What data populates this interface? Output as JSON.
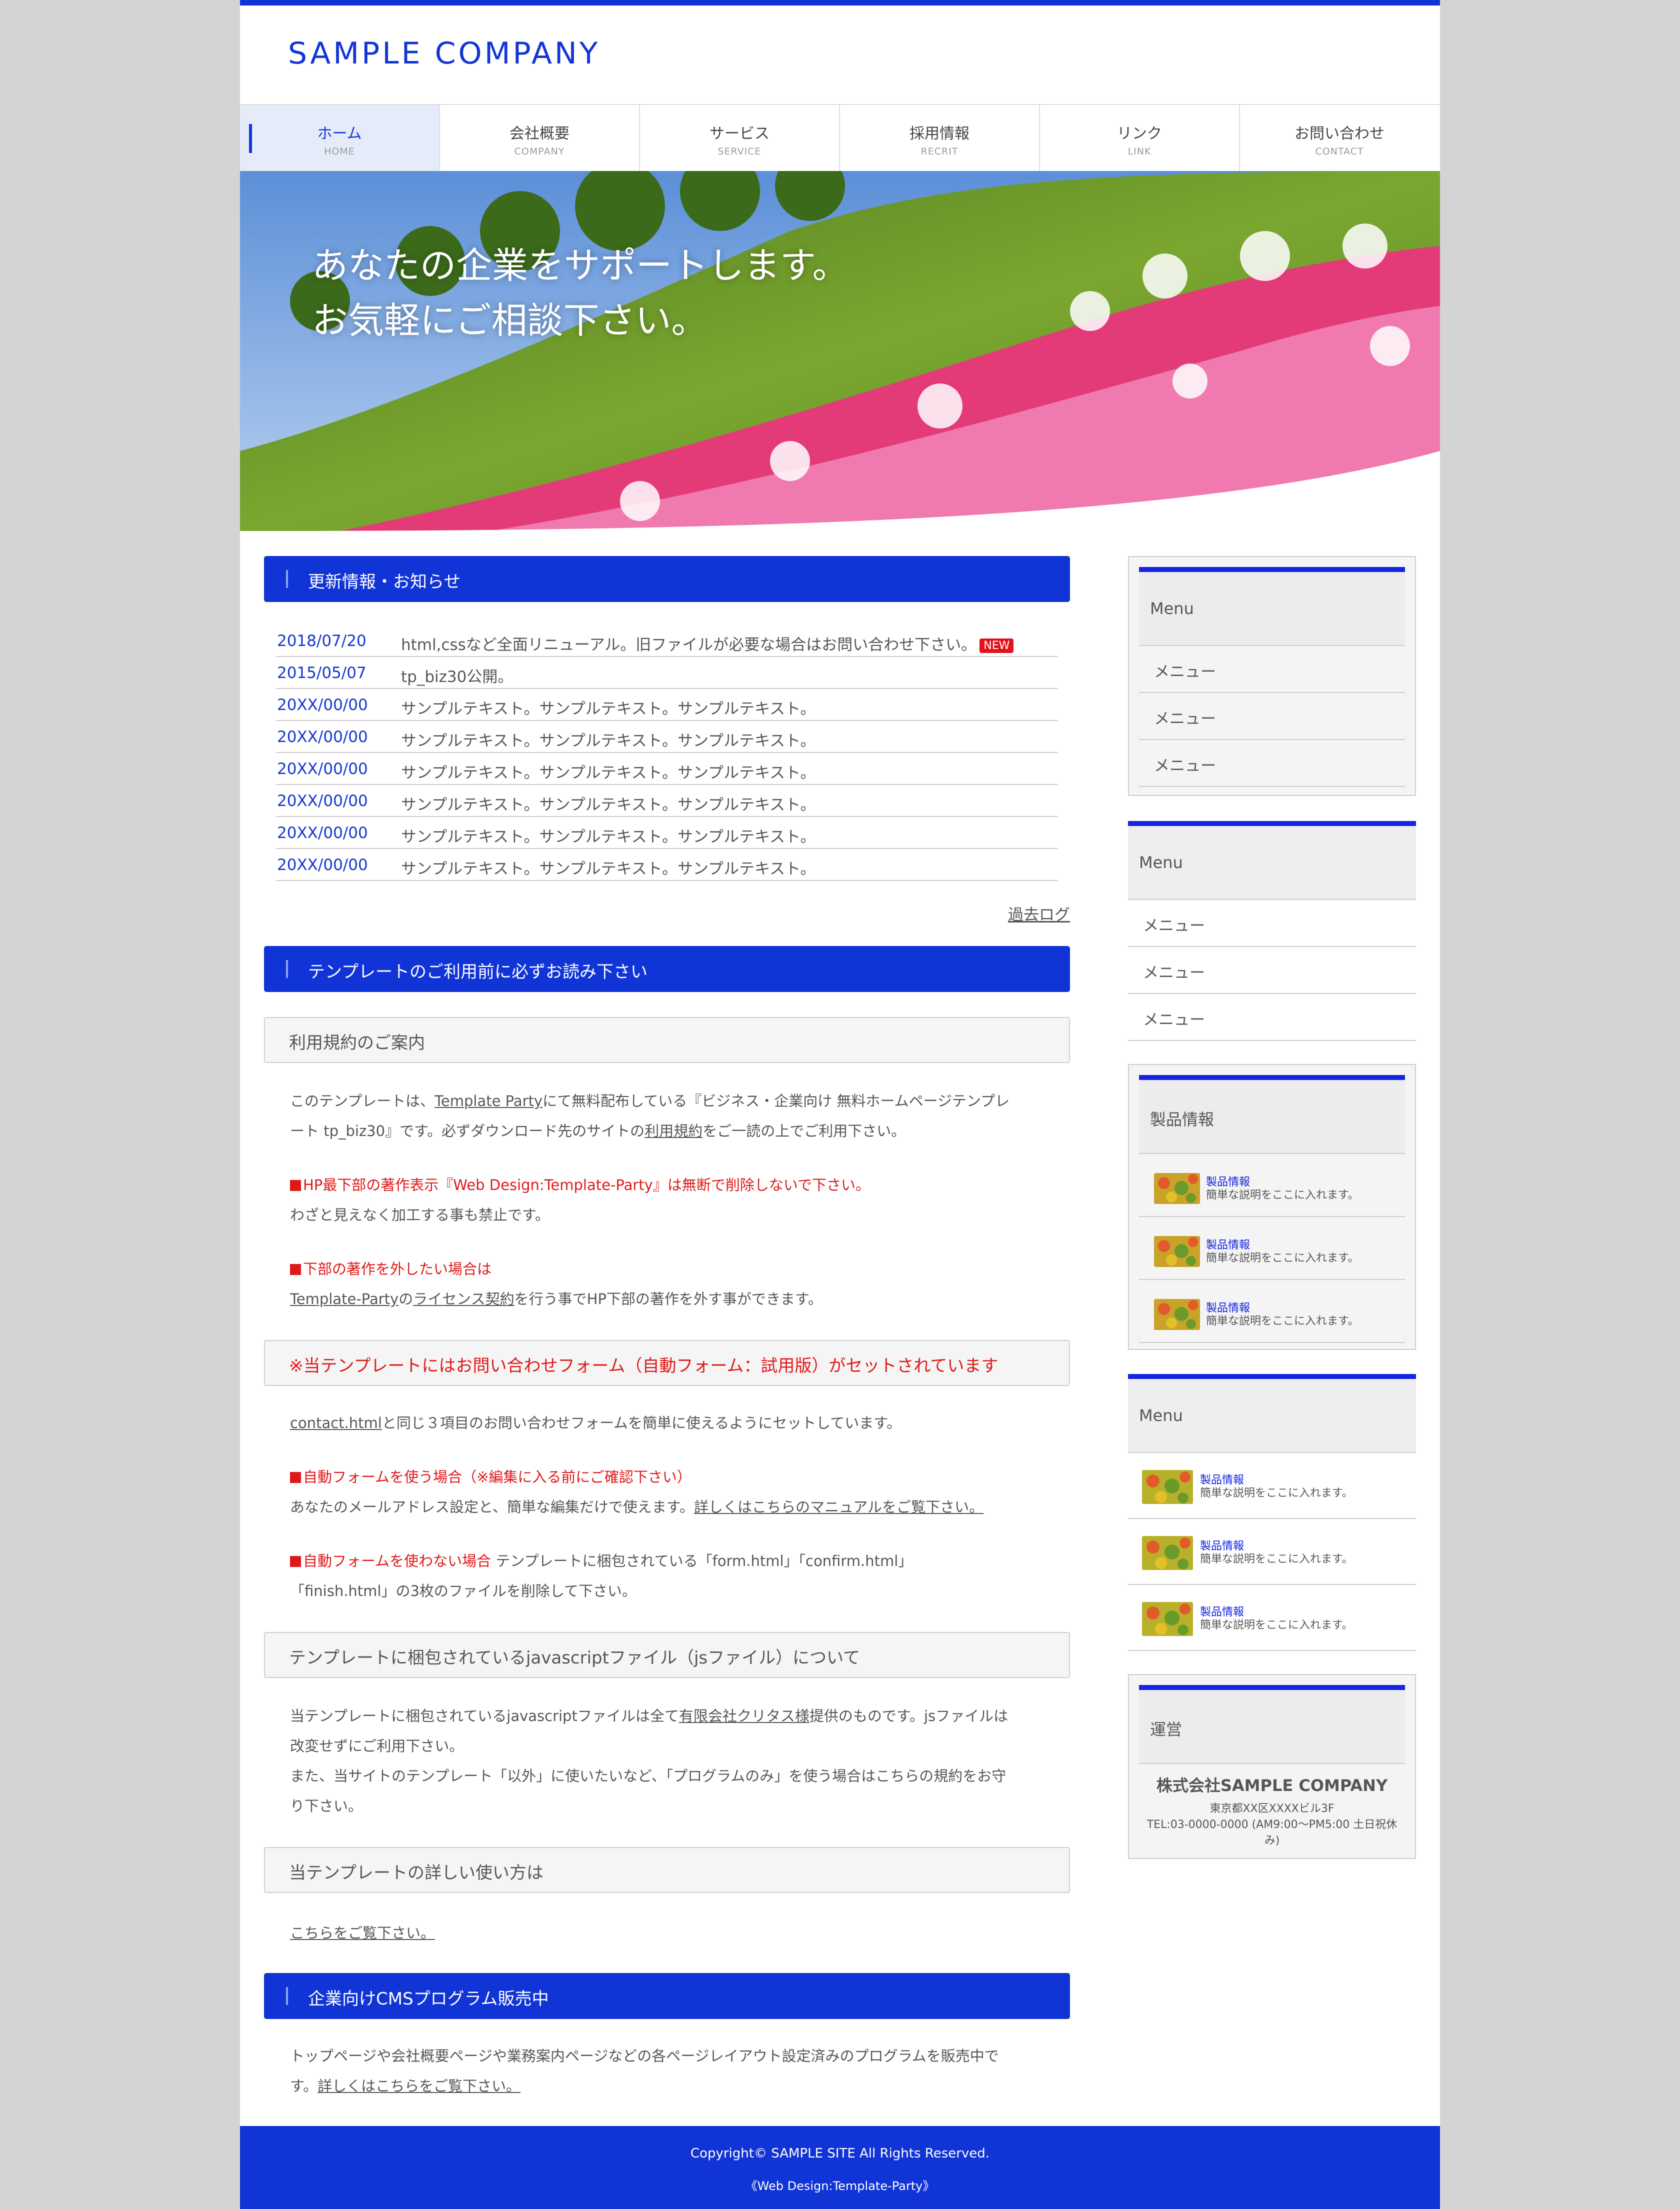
{
  "site": {
    "logo": "SAMPLE COMPANY"
  },
  "nav": [
    {
      "jp": "ホーム",
      "en": "HOME"
    },
    {
      "jp": "会社概要",
      "en": "COMPANY"
    },
    {
      "jp": "サービス",
      "en": "SERVICE"
    },
    {
      "jp": "採用情報",
      "en": "RECRIT"
    },
    {
      "jp": "リンク",
      "en": "LINK"
    },
    {
      "jp": "お問い合わせ",
      "en": "CONTACT"
    }
  ],
  "hero": {
    "line1": "あなたの企業をサポートします。",
    "line2": "お気軽にご相談下さい。"
  },
  "news": {
    "heading": "更新情報・お知らせ",
    "items": [
      {
        "date": "2018/07/20",
        "text": "html,cssなど全面リニューアル。旧ファイルが必要な場合はお問い合わせ下さい。",
        "badge": "NEW"
      },
      {
        "date": "2015/05/07",
        "text": "tp_biz30公開。"
      },
      {
        "date": "20XX/00/00",
        "text": "サンプルテキスト。サンプルテキスト。サンプルテキスト。"
      },
      {
        "date": "20XX/00/00",
        "text": "サンプルテキスト。サンプルテキスト。サンプルテキスト。"
      },
      {
        "date": "20XX/00/00",
        "text": "サンプルテキスト。サンプルテキスト。サンプルテキスト。"
      },
      {
        "date": "20XX/00/00",
        "text": "サンプルテキスト。サンプルテキスト。サンプルテキスト。"
      },
      {
        "date": "20XX/00/00",
        "text": "サンプルテキスト。サンプルテキスト。サンプルテキスト。"
      },
      {
        "date": "20XX/00/00",
        "text": "サンプルテキスト。サンプルテキスト。サンプルテキスト。"
      }
    ],
    "past_log": "過去ログ"
  },
  "template": {
    "heading": "テンプレートのご利用前に必ずお読み下さい",
    "terms_heading": "利用規約のご案内",
    "terms_p1_a": "このテンプレートは、",
    "terms_p1_link": "Template Party",
    "terms_p1_b": "にて無料配布している『ビジネス・企業向け 無料ホームページテンプレ",
    "terms_p1_c": "ート tp_biz30』です。必ずダウンロード先のサイトの",
    "terms_p1_link2": "利用規約",
    "terms_p1_d": "をご一読の上でご利用下さい。",
    "credit_red": "HP最下部の著作表示『Web Design:Template-Party』は無断で削除しないで下さい。",
    "credit_note": "わざと見えなく加工する事も禁止です。",
    "remove_red": "下部の著作を外したい場合は",
    "remove_link1": "Template-Party",
    "remove_mid": "の",
    "remove_link2": "ライセンス契約",
    "remove_end": "を行う事でHP下部の著作を外す事ができます。",
    "form_heading": "※当テンプレートにはお問い合わせフォーム（自動フォーム：試用版）がセットされています",
    "form_link": "contact.html",
    "form_text": "と同じ３項目のお問い合わせフォームを簡単に使えるようにセットしています。",
    "auto_red": "自動フォームを使う場合（※編集に入る前にご確認下さい）",
    "auto_text": "あなたのメールアドレス設定と、簡単な編集だけで使えます。",
    "auto_link": "詳しくはこちらのマニュアルをご覧下さい。",
    "noauto_red": "自動フォームを使わない場合",
    "noauto_text1": " テンプレートに梱包されている「form.html」「confirm.html」",
    "noauto_text2": "「finish.html」の3枚のファイルを削除して下さい。",
    "js_heading": "テンプレートに梱包されているjavascriptファイル（jsファイル）について",
    "js_text1_a": "当テンプレートに梱包されているjavascriptファイルは全て",
    "js_text1_link": "有限会社クリタス様",
    "js_text1_b": "提供のものです。jsファイルは",
    "js_text2": "改変せずにご利用下さい。",
    "js_text3": "また、当サイトのテンプレート「以外」に使いたいなど、「プログラムのみ」を使う場合はこちらの規約をお守",
    "js_text4": "り下さい。",
    "usage_heading": "当テンプレートの詳しい使い方は",
    "usage_link": "こちらをご覧下さい。"
  },
  "cms": {
    "heading": "企業向けCMSプログラム販売中",
    "text1": "トップページや会社概要ページや業務案内ページなどの各ページレイアウト設定済みのプログラムを販売中で",
    "text2": "す。",
    "link": "詳しくはこちらをご覧下さい。"
  },
  "side": {
    "menu1": {
      "title": "Menu",
      "items": [
        "メニュー",
        "メニュー",
        "メニュー"
      ]
    },
    "menu2": {
      "title": "Menu",
      "items": [
        "メニュー",
        "メニュー",
        "メニュー"
      ]
    },
    "products": {
      "title": "製品情報",
      "items": [
        {
          "title": "製品情報",
          "desc": "簡単な説明をここに入れます。"
        },
        {
          "title": "製品情報",
          "desc": "簡単な説明をここに入れます。"
        },
        {
          "title": "製品情報",
          "desc": "簡単な説明をここに入れます。"
        }
      ]
    },
    "menu3": {
      "title": "Menu",
      "items": [
        {
          "title": "製品情報",
          "desc": "簡単な説明をここに入れます。"
        },
        {
          "title": "製品情報",
          "desc": "簡単な説明をここに入れます。"
        },
        {
          "title": "製品情報",
          "desc": "簡単な説明をここに入れます。"
        }
      ]
    },
    "operator": {
      "title": "運営",
      "company": "株式会社SAMPLE COMPANY",
      "addr1": "東京都XX区XXXXビル3F",
      "addr2": "TEL:03-0000-0000 (AM9:00〜PM5:00 土日祝休",
      "addr3": "み)"
    }
  },
  "footer": {
    "copyright": "Copyright© SAMPLE SITE All Rights Reserved.",
    "credit": "《Web Design:Template-Party》"
  },
  "colors": {
    "brand": "#1134d6",
    "accent_red": "#e01818",
    "date_blue": "#1334d0"
  }
}
